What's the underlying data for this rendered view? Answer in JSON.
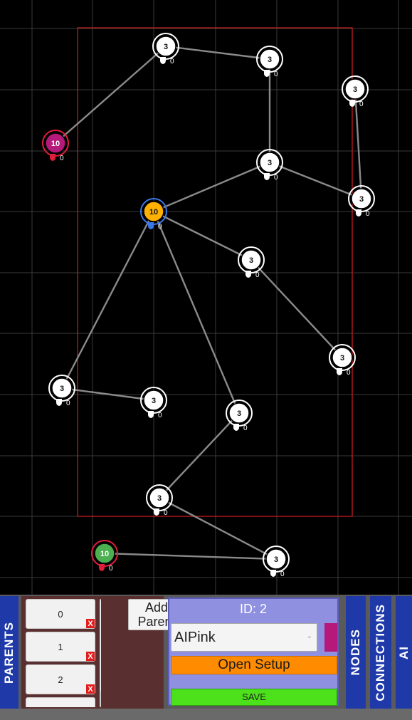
{
  "graph": {
    "nodes": [
      {
        "id": "n1",
        "value": "3",
        "shield": "0",
        "kind": "neutral"
      },
      {
        "id": "n2",
        "value": "3",
        "shield": "0",
        "kind": "neutral"
      },
      {
        "id": "n3",
        "value": "3",
        "shield": "0",
        "kind": "neutral"
      },
      {
        "id": "n4",
        "value": "10",
        "shield": "0",
        "kind": "pink"
      },
      {
        "id": "n5",
        "value": "3",
        "shield": "0",
        "kind": "neutral"
      },
      {
        "id": "n6",
        "value": "3",
        "shield": "0",
        "kind": "neutral"
      },
      {
        "id": "n7",
        "value": "10",
        "shield": "0",
        "kind": "orange"
      },
      {
        "id": "n8",
        "value": "3",
        "shield": "0",
        "kind": "neutral"
      },
      {
        "id": "n9",
        "value": "3",
        "shield": "0",
        "kind": "neutral"
      },
      {
        "id": "n10",
        "value": "3",
        "shield": "0",
        "kind": "neutral"
      },
      {
        "id": "n11",
        "value": "3",
        "shield": "0",
        "kind": "neutral"
      },
      {
        "id": "n12",
        "value": "3",
        "shield": "0",
        "kind": "neutral"
      },
      {
        "id": "n13",
        "value": "3",
        "shield": "0",
        "kind": "neutral"
      },
      {
        "id": "n14",
        "value": "10",
        "shield": "0",
        "kind": "green"
      },
      {
        "id": "n15",
        "value": "3",
        "shield": "0",
        "kind": "neutral"
      }
    ],
    "edges": [
      [
        "n1",
        "n2"
      ],
      [
        "n1",
        "n4"
      ],
      [
        "n2",
        "n5"
      ],
      [
        "n3",
        "n6"
      ],
      [
        "n5",
        "n6"
      ],
      [
        "n5",
        "n7"
      ],
      [
        "n7",
        "n8"
      ],
      [
        "n8",
        "n9"
      ],
      [
        "n7",
        "n10"
      ],
      [
        "n7",
        "n12"
      ],
      [
        "n10",
        "n11"
      ],
      [
        "n12",
        "n13"
      ],
      [
        "n13",
        "n15"
      ],
      [
        "n14",
        "n15"
      ]
    ],
    "kinds": {
      "neutral": {
        "fill": "#ffffff",
        "ring": "#ffffff",
        "text": "#111111",
        "shield": "#ffffff"
      },
      "pink": {
        "fill": "#b5197a",
        "ring": "#e01e3c",
        "text": "#ffffff",
        "shield": "#e01e3c"
      },
      "orange": {
        "fill": "#ffb000",
        "ring": "#3b78e7",
        "text": "#111111",
        "shield": "#3b78e7"
      },
      "green": {
        "fill": "#4caf50",
        "ring": "#e01e3c",
        "text": "#ffffff",
        "shield": "#e01e3c"
      }
    }
  },
  "tabs": {
    "parents": "PARENTS",
    "nodes": "NODES",
    "connections": "CONNECTIONS",
    "ai": "AI"
  },
  "parents": {
    "items": [
      {
        "label": "0",
        "remove": "X"
      },
      {
        "label": "1",
        "remove": "X"
      },
      {
        "label": "2",
        "remove": "X"
      }
    ],
    "add_label": "Add Parent"
  },
  "node_panel": {
    "id_label": "ID: 2",
    "ai_selected": "AIPink",
    "swatch_color": "#b5197a",
    "open_setup_label": "Open Setup",
    "save_label": "SAVE"
  }
}
